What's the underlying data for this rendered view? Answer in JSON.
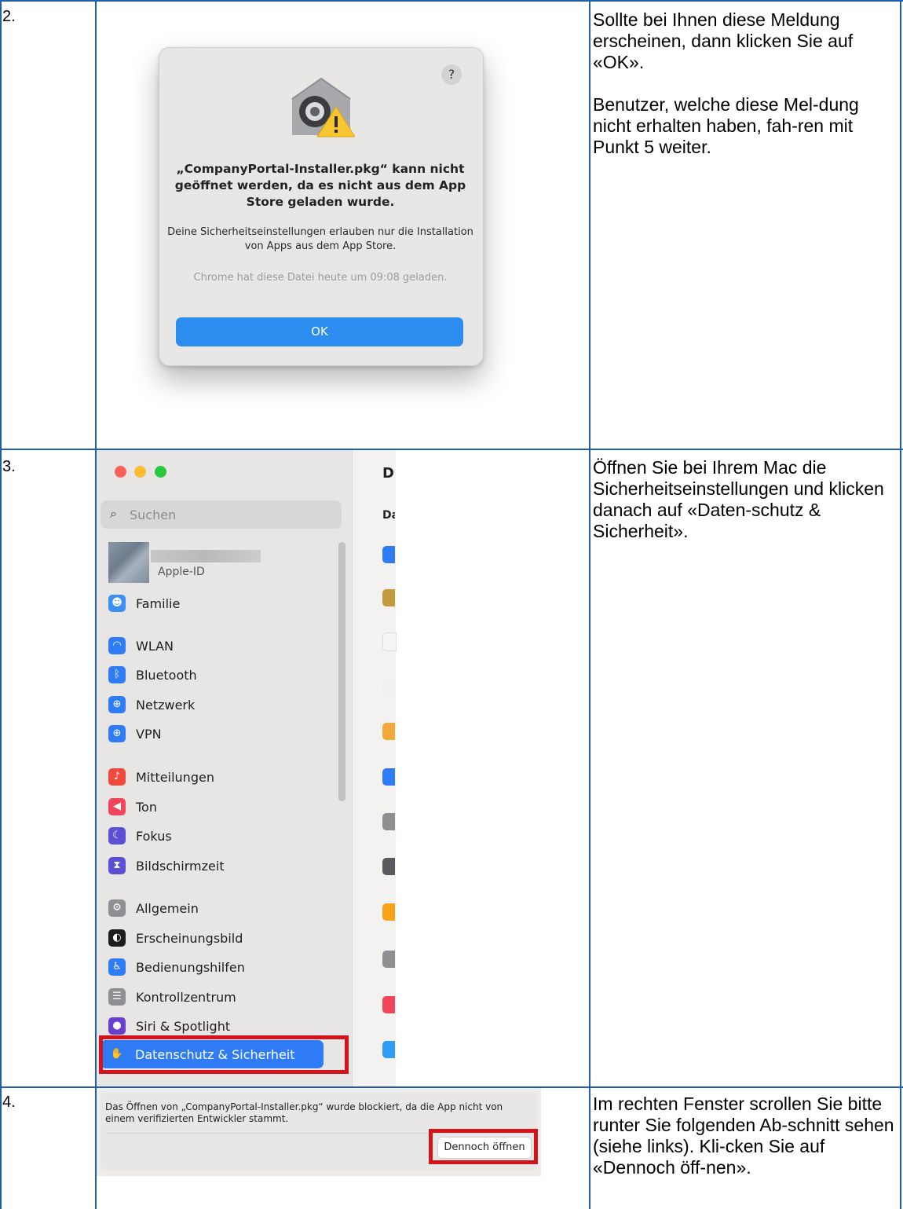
{
  "steps": [
    {
      "number": "2.",
      "description": "Sollte bei Ihnen diese Meldung erscheinen, dann klicken Sie auf «OK».\n\nBenutzer, welche diese Mel-dung nicht erhalten haben, fah-ren mit Punkt 5 weiter.",
      "dialog": {
        "help": "?",
        "title": "„CompanyPortal-Installer.pkg“ kann nicht geöffnet werden, da es nicht aus dem App Store geladen wurde.",
        "body": "Deine Sicherheitseinstellungen erlauben nur die Installation von Apps aus dem App Store.",
        "note": "Chrome hat diese Datei heute um 09:08 geladen.",
        "ok_label": "OK",
        "accent": "#2d8cf0"
      }
    },
    {
      "number": "3.",
      "description": "Öffnen Sie bei Ihrem Mac die Sicherheitseinstellungen und klicken danach auf «Daten-schutz & Sicherheit».",
      "settings": {
        "search_placeholder": "Suchen",
        "account_label": "Apple-ID",
        "sidebar": [
          {
            "label": "Familie",
            "icon": "family-icon",
            "color": "#3b8ef3"
          },
          {
            "label": "WLAN",
            "icon": "wifi-icon",
            "color": "#2f7cf6"
          },
          {
            "label": "Bluetooth",
            "icon": "bluetooth-icon",
            "color": "#2f7cf6"
          },
          {
            "label": "Netzwerk",
            "icon": "globe-icon",
            "color": "#2f7cf6"
          },
          {
            "label": "VPN",
            "icon": "vpn-icon",
            "color": "#2f7cf6"
          },
          {
            "label": "Mitteilungen",
            "icon": "bell-icon",
            "color": "#f04a3f"
          },
          {
            "label": "Ton",
            "icon": "speaker-icon",
            "color": "#f0455a"
          },
          {
            "label": "Fokus",
            "icon": "moon-icon",
            "color": "#5b4fd6"
          },
          {
            "label": "Bildschirmzeit",
            "icon": "hourglass-icon",
            "color": "#5b4fd6"
          },
          {
            "label": "Allgemein",
            "icon": "gear-icon",
            "color": "#8e8e93"
          },
          {
            "label": "Erscheinungsbild",
            "icon": "appearance-icon",
            "color": "#1c1c1e"
          },
          {
            "label": "Bedienungshilfen",
            "icon": "accessibility-icon",
            "color": "#2f7cf6"
          },
          {
            "label": "Kontrollzentrum",
            "icon": "control-center-icon",
            "color": "#8e8e93"
          },
          {
            "label": "Siri & Spotlight",
            "icon": "siri-icon",
            "color": "#6a3fd0"
          },
          {
            "label": "Datenschutz & Sicherheit",
            "icon": "hand-icon",
            "color": "#2f7cf6"
          }
        ],
        "right_header": "D",
        "right_subheader": "Da",
        "traffic_lights": [
          "#fe5f57",
          "#febc2e",
          "#28c840"
        ],
        "highlight_color": "#d4141d"
      }
    },
    {
      "number": "4.",
      "description": "Im rechten Fenster scrollen Sie bitte runter Sie folgenden Ab-schnitt sehen (siehe links). Kli-cken Sie auf «Dennoch öff-nen».",
      "warning": {
        "text": "Das Öffnen von „CompanyPortal-Installer.pkg“ wurde blockiert, da die App nicht von einem verifizierten Entwickler stammt.",
        "button_label": "Dennoch öffnen"
      }
    }
  ]
}
